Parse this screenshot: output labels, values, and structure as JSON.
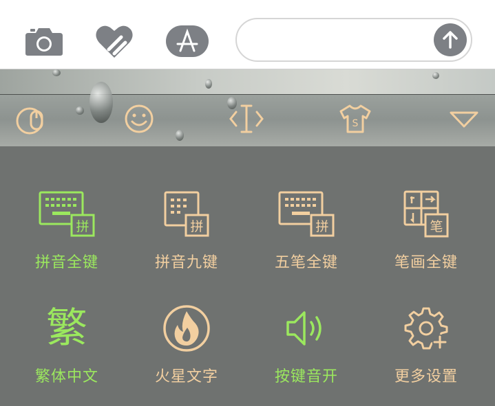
{
  "colors": {
    "accent_green": "#9be85e",
    "accent_tan": "#f2cfa0",
    "panel_bg": "#6f7270",
    "icon_gray": "#7d8085"
  },
  "message_bar": {
    "icons": [
      "camera-icon",
      "heart-stickers-icon",
      "app-store-icon"
    ],
    "input_value": "",
    "send_icon": "arrow-up-icon"
  },
  "toolbar": {
    "icons": [
      "keyboard-logo-icon",
      "emoji-icon",
      "cursor-icon",
      "skin-shirt-icon",
      "collapse-triangle-icon"
    ]
  },
  "menu": {
    "items": [
      {
        "label": "拼音全键",
        "icon": "pinyin-full-keyboard-icon",
        "active": true
      },
      {
        "label": "拼音九键",
        "icon": "pinyin-nine-key-icon",
        "active": false
      },
      {
        "label": "五笔全键",
        "icon": "wubi-full-keyboard-icon",
        "active": false
      },
      {
        "label": "笔画全键",
        "icon": "stroke-full-keyboard-icon",
        "active": false
      },
      {
        "label": "繁体中文",
        "icon": "traditional-chinese-icon",
        "glyph": "繁",
        "active": true
      },
      {
        "label": "火星文字",
        "icon": "mars-text-flame-icon",
        "active": false
      },
      {
        "label": "按键音开",
        "icon": "key-sound-on-icon",
        "active": true
      },
      {
        "label": "更多设置",
        "icon": "more-settings-gear-icon",
        "active": false
      }
    ]
  }
}
